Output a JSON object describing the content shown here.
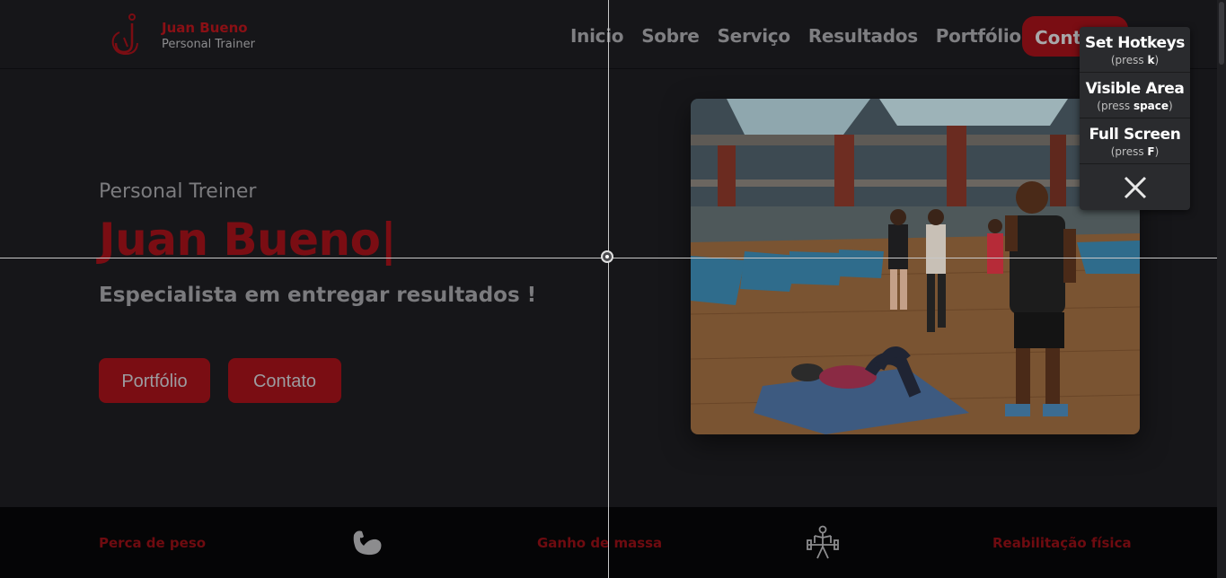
{
  "brand": {
    "name": "Juan Bueno",
    "subtitle": "Personal Trainer"
  },
  "nav": {
    "items": [
      "Inicio",
      "Sobre",
      "Serviço",
      "Resultados",
      "Portfólio"
    ],
    "cta": "Contato"
  },
  "hero": {
    "eyebrow": "Personal Treiner",
    "title": "Juan Bueno",
    "cursor": "|",
    "subtitle": "Especialista em entregar resultados !",
    "buttons": [
      "Portfólio",
      "Contato"
    ]
  },
  "services": [
    "Perca de peso",
    "Ganho de massa",
    "Reabilitação física"
  ],
  "icons": [
    "logo-icon",
    "bicep-icon",
    "weightlifter-icon",
    "close-icon"
  ],
  "tool_panel": {
    "items": [
      {
        "label": "Set Hotkeys",
        "press_prefix": "(press ",
        "key": "k",
        "press_suffix": ")"
      },
      {
        "label": "Visible Area",
        "press_prefix": "(press ",
        "key": "space",
        "press_suffix": ")"
      },
      {
        "label": "Full Screen",
        "press_prefix": "(press ",
        "key": "F",
        "press_suffix": ")"
      }
    ]
  },
  "colors": {
    "accent": "#7a0d13",
    "background": "#161619",
    "band": "#050506",
    "muted_text": "#7f7f82"
  }
}
